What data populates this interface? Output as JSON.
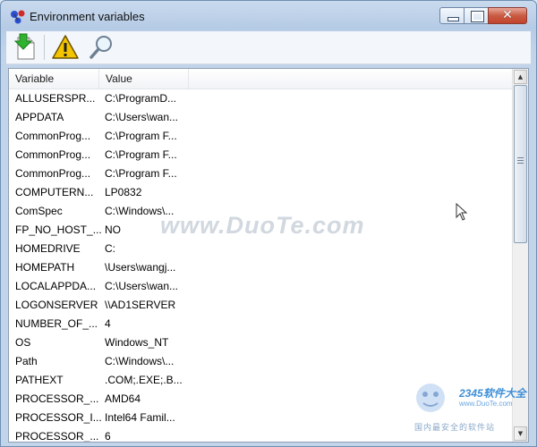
{
  "window": {
    "title": "Environment variables",
    "close_glyph": "✕"
  },
  "toolbar": {
    "buttons": [
      {
        "icon": "download-file-icon"
      },
      {
        "icon": "warning-icon"
      },
      {
        "icon": "magnifier-icon"
      }
    ]
  },
  "table": {
    "columns": [
      "Variable",
      "Value"
    ],
    "rows": [
      [
        "ALLUSERSPR...",
        "C:\\ProgramD..."
      ],
      [
        "APPDATA",
        "C:\\Users\\wan..."
      ],
      [
        "CommonProg...",
        "C:\\Program F..."
      ],
      [
        "CommonProg...",
        "C:\\Program F..."
      ],
      [
        "CommonProg...",
        "C:\\Program F..."
      ],
      [
        "COMPUTERN...",
        "LP0832"
      ],
      [
        "ComSpec",
        "C:\\Windows\\..."
      ],
      [
        "FP_NO_HOST_...",
        "NO"
      ],
      [
        "HOMEDRIVE",
        "C:"
      ],
      [
        "HOMEPATH",
        "\\Users\\wangj..."
      ],
      [
        "LOCALAPPDA...",
        "C:\\Users\\wan..."
      ],
      [
        "LOGONSERVER",
        "\\\\AD1SERVER"
      ],
      [
        "NUMBER_OF_...",
        "4"
      ],
      [
        "OS",
        "Windows_NT"
      ],
      [
        "Path",
        "C:\\Windows\\..."
      ],
      [
        "PATHEXT",
        ".COM;.EXE;.B..."
      ],
      [
        "PROCESSOR_...",
        "AMD64"
      ],
      [
        "PROCESSOR_I...",
        "Intel64 Famil..."
      ],
      [
        "PROCESSOR_...",
        "6"
      ]
    ]
  },
  "scrollbar": {
    "up_arrow": "▲",
    "down_arrow": "▼"
  },
  "watermark": {
    "text": "www.DuoTe.com",
    "corner_brand": "2345软件大全",
    "corner_url": "www.DuoTe.com",
    "corner_sub": "国内最安全的软件站"
  },
  "colors": {
    "titlebar": "#c9daee",
    "close_button": "#c95b42",
    "list_bg": "#ffffff"
  }
}
